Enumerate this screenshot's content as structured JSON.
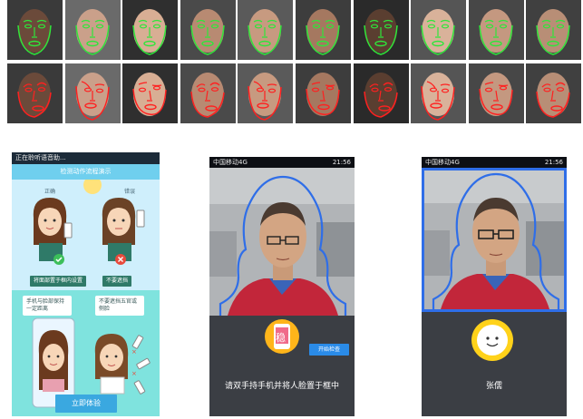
{
  "phone_tutorial": {
    "status_left": "正在聆听语音助...",
    "title": "检测动作流程演示",
    "label_left": "正确",
    "label_right": "错误",
    "caption_left": "将面部置于框内设置",
    "caption_right": "不要遮挡",
    "bubble_left": "手机与脸部保持一定距离",
    "bubble_right": "不要遮挡五官或侧脸",
    "cta_label": "立即体验"
  },
  "phone_capture": {
    "carrier": "中国移动4G",
    "time": "21:56",
    "badge_char": "稳",
    "start_button": "开始检查",
    "instruction": "请双手持手机并将人脸置于框中"
  },
  "phone_result": {
    "carrier": "中国移动4G",
    "time": "21:56",
    "name": "张儒"
  },
  "colors": {
    "landmark_good": "#2ee63a",
    "landmark_bad": "#ff2020",
    "frame_blue": "#2f6ee8",
    "smiley_yellow": "#ffd21a"
  }
}
